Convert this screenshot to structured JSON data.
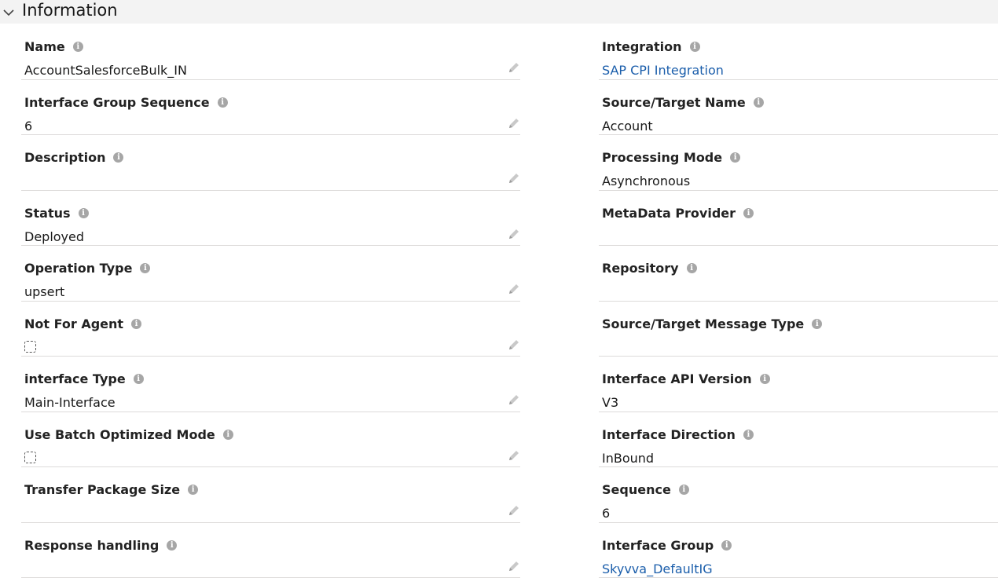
{
  "section": {
    "title": "Information"
  },
  "left_fields": [
    {
      "label": "Name",
      "value": "AccountSalesforceBulk_IN"
    },
    {
      "label": "Interface Group Sequence",
      "value": "6"
    },
    {
      "label": "Description",
      "value": ""
    },
    {
      "label": "Status",
      "value": "Deployed"
    },
    {
      "label": "Operation Type",
      "value": "upsert"
    },
    {
      "label": "Not For Agent",
      "checked": false
    },
    {
      "label": "interface Type",
      "value": "Main-Interface"
    },
    {
      "label": "Use Batch Optimized Mode",
      "checked": false
    },
    {
      "label": "Transfer Package Size",
      "value": ""
    },
    {
      "label": "Response handling",
      "value": ""
    }
  ],
  "right_fields": [
    {
      "label": "Integration",
      "value": "SAP CPI Integration"
    },
    {
      "label": "Source/Target Name",
      "value": "Account"
    },
    {
      "label": "Processing Mode",
      "value": "Asynchronous"
    },
    {
      "label": "MetaData Provider",
      "value": ""
    },
    {
      "label": "Repository",
      "value": ""
    },
    {
      "label": "Source/Target Message Type",
      "value": ""
    },
    {
      "label": "Interface API Version",
      "value": "V3"
    },
    {
      "label": "Interface Direction",
      "value": "InBound"
    },
    {
      "label": "Sequence",
      "value": "6"
    },
    {
      "label": "Interface Group",
      "value": "Skyvva_DefaultIG"
    }
  ],
  "icons": {
    "info": "info-icon",
    "edit": "pencil-icon",
    "collapse": "chevron-down-icon"
  },
  "colors": {
    "link": "#1b5eab",
    "header_bg": "#f3f3f3",
    "divider": "#dddbda"
  }
}
